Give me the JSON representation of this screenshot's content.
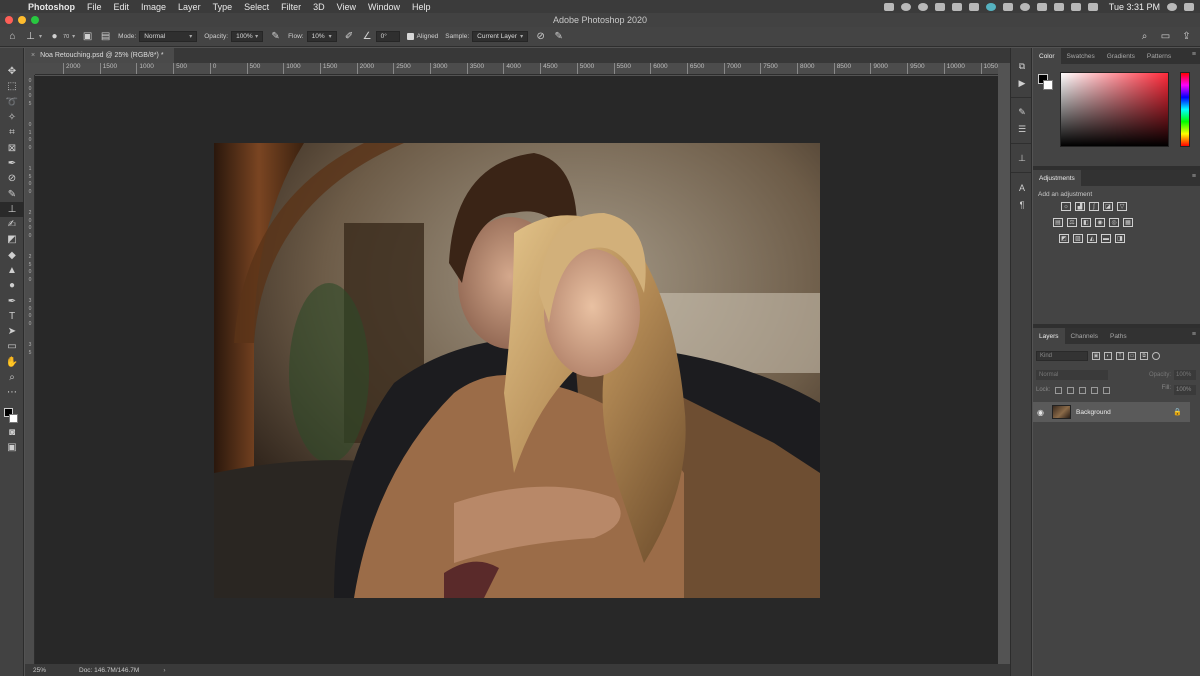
{
  "menubar": {
    "apple": "",
    "items": [
      "Photoshop",
      "File",
      "Edit",
      "Image",
      "Layer",
      "Type",
      "Select",
      "Filter",
      "3D",
      "View",
      "Window",
      "Help"
    ],
    "clock": "Tue 3:31 PM"
  },
  "window": {
    "title": "Adobe Photoshop 2020"
  },
  "options": {
    "brush_size": "70",
    "mode_label": "Mode:",
    "mode_value": "Normal",
    "opacity_label": "Opacity:",
    "opacity_value": "100%",
    "flow_label": "Flow:",
    "flow_value": "10%",
    "angle_value": "0°",
    "aligned_label": "Aligned",
    "sample_label": "Sample:",
    "sample_value": "Current Layer"
  },
  "document": {
    "tab_title": "Noa Retouching.psd @ 25% (RGB/8*) *",
    "close": "×"
  },
  "ruler": {
    "h_ticks": [
      "2000",
      "1500",
      "1000",
      "500",
      "0",
      "500",
      "1000",
      "1500",
      "2000",
      "2500",
      "3000",
      "3500",
      "4000",
      "4500",
      "5000",
      "5500",
      "6000",
      "6500",
      "7000",
      "7500",
      "8000",
      "8500",
      "9000",
      "9500",
      "10000",
      "1050"
    ],
    "v_ticks": [
      "0",
      "0",
      "0",
      "5",
      "0",
      "1",
      "0",
      "0",
      "1",
      "5",
      "0",
      "0",
      "2",
      "0",
      "0",
      "0",
      "2",
      "5",
      "0",
      "0",
      "3",
      "0",
      "0",
      "0",
      "3",
      "5"
    ]
  },
  "status": {
    "zoom": "25%",
    "doc_size": "Doc: 146.7M/146.7M",
    "arrow": "›"
  },
  "panels": {
    "color_tabs": [
      "Color",
      "Swatches",
      "Gradients",
      "Patterns"
    ],
    "adjustments_tab": "Adjustments",
    "add_adjustment": "Add an adjustment",
    "layers_tabs": [
      "Layers",
      "Channels",
      "Paths"
    ],
    "layers_kind_placeholder": "Kind",
    "layers_blend": "Normal",
    "layers_opacity_label": "Opacity:",
    "layers_opacity_value": "100%",
    "layers_lock_label": "Lock:",
    "layers_fill_label": "Fill:",
    "layers_fill_value": "100%",
    "layer_name": "Background"
  },
  "colors": {
    "foreground": "#000000",
    "background": "#ffffff",
    "picker_hue": "#ff2a3a"
  }
}
